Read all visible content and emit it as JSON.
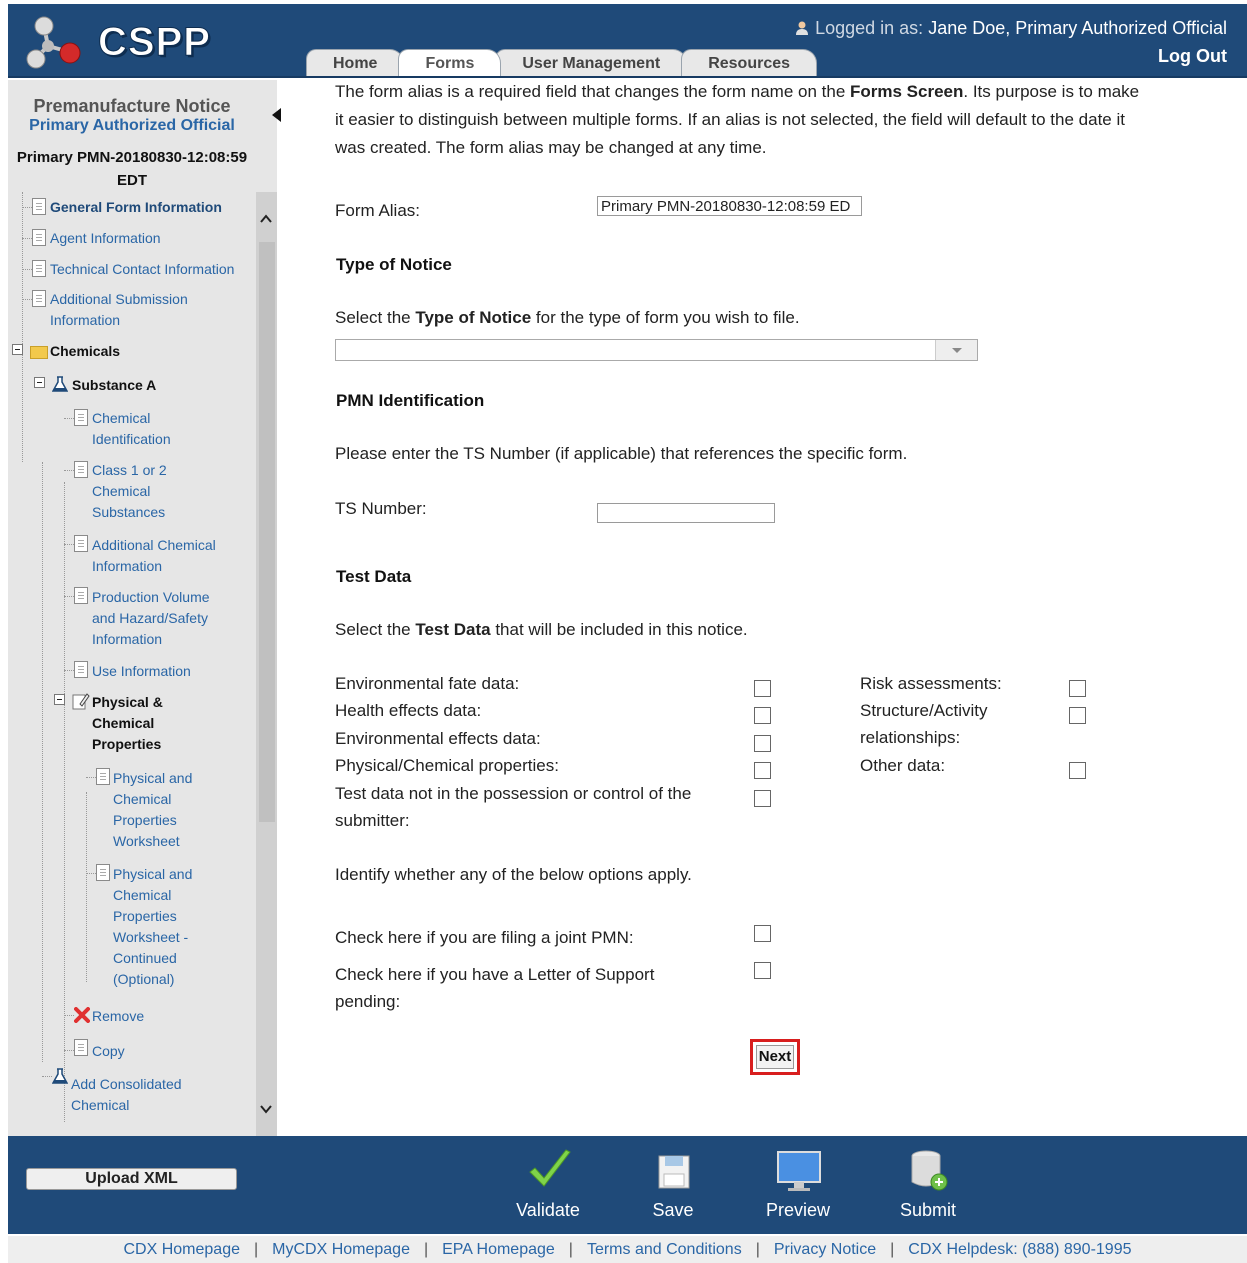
{
  "header": {
    "logo_text": "CSPP",
    "logged_in_prefix": "Logged in as:",
    "logged_in_user": "Jane Doe, Primary Authorized Official",
    "logout_label": "Log Out"
  },
  "tabs": [
    {
      "label": "Home",
      "active": false
    },
    {
      "label": "Forms",
      "active": true
    },
    {
      "label": "User Management",
      "active": false
    },
    {
      "label": "Resources",
      "active": false
    }
  ],
  "sidebar": {
    "title": "Premanufacture Notice",
    "subtitle": "Primary Authorized Official",
    "form_name_line1": "Primary PMN-20180830-12:08:59",
    "form_name_line2": "EDT",
    "items": {
      "general": "General Form Information",
      "agent": "Agent Information",
      "technical": "Technical Contact Information",
      "additional_1": "Additional Submission",
      "additional_2": "Information",
      "chemicals": "Chemicals",
      "substance": "Substance A",
      "chem_id_1": "Chemical",
      "chem_id_2": "Identification",
      "class_1": "Class 1 or 2",
      "class_2": "Chemical",
      "class_3": "Substances",
      "add_chem_1": "Additional Chemical",
      "add_chem_2": "Information",
      "prod_1": "Production Volume",
      "prod_2": "and Hazard/Safety",
      "prod_3": "Information",
      "use": "Use Information",
      "phys_1": "Physical &",
      "phys_2": "Chemical",
      "phys_3": "Properties",
      "pcw_1": "Physical and",
      "pcw_2": "Chemical",
      "pcw_3": "Properties",
      "pcw_4": "Worksheet",
      "pcwc_1": "Physical and",
      "pcwc_2": "Chemical",
      "pcwc_3": "Properties",
      "pcwc_4": "Worksheet -",
      "pcwc_5": "Continued",
      "pcwc_6": "(Optional)",
      "remove": "Remove",
      "copy": "Copy",
      "consolidated_1": "Add Consolidated",
      "consolidated_2": "Chemical"
    }
  },
  "main": {
    "intro_line1_pre": "The form alias is a required field that changes the form name on the ",
    "intro_line1_bold": "Forms Screen",
    "intro_line1_post": ". Its purpose is to make",
    "intro_line2": "it easier to distinguish between multiple forms. If an alias is not selected, the field will default to the date it",
    "intro_line3": "was created. The form alias may be changed at any time.",
    "form_alias_label": "Form Alias:",
    "form_alias_value": "Primary PMN-20180830-12:08:59 ED",
    "type_heading": "Type of Notice",
    "type_pre": "Select the ",
    "type_bold": "Type of Notice",
    "type_post": " for the type of form you wish to file.",
    "type_selected": "",
    "pmn_heading": "PMN Identification",
    "ts_instruction": "Please enter the TS Number (if applicable) that references the specific form.",
    "ts_label": "TS Number:",
    "ts_value": "",
    "test_heading": "Test Data",
    "test_pre": "Select the ",
    "test_bold": "Test Data",
    "test_post": " that will be included in this notice.",
    "checks_left": [
      "Environmental fate data:",
      "Health effects data:",
      "Environmental effects data:",
      "Physical/Chemical properties:",
      "Test data not in the possession or control of the",
      "submitter:"
    ],
    "checks_right": [
      "Risk assessments:",
      "Structure/Activity",
      "relationships:",
      "Other data:"
    ],
    "options_instruction": "Identify whether any of the below options apply.",
    "joint_label": "Check here if you are filing a joint PMN:",
    "letter_label_1": "Check here if you have a Letter of Support",
    "letter_label_2": "pending:",
    "next_label": "Next"
  },
  "toolbar": {
    "upload": "Upload XML",
    "validate": "Validate",
    "save": "Save",
    "preview": "Preview",
    "submit": "Submit"
  },
  "footer": {
    "links": [
      "CDX Homepage",
      "MyCDX Homepage",
      "EPA Homepage",
      "Terms and Conditions",
      "Privacy Notice",
      "CDX Helpdesk: (888) 890-1995"
    ]
  }
}
